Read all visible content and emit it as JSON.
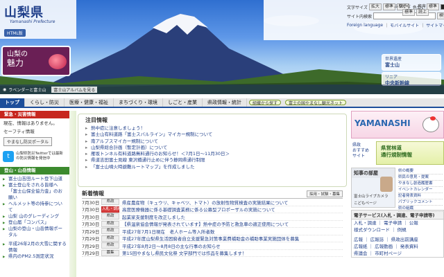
{
  "header": {
    "logo_title": "山梨県",
    "logo_sub": "Yamanashi Prefecture",
    "html_btn": "HTML版",
    "font_size_label": "文字サイズ",
    "font_enlarge": "拡大",
    "font_normal": "標準",
    "font_shrink": "縮小",
    "color_label": "色合い",
    "color_normal": "標準",
    "furigana": "ふりがな",
    "audio": "音声",
    "furigana_normal": "標準",
    "audio_read": "読上",
    "search_label": "サイト内検索",
    "search_button": "検索",
    "link_foreign": "Foreign language",
    "link_mobile": "モバイルサイト",
    "link_sitemap": "サイトマップ"
  },
  "hero": {
    "miryoku_line1": "山梨の",
    "miryoku_line2": "魅力",
    "banner1_line1": "世界遺産",
    "banner1_line2": "富士山",
    "banner2_line1": "リニア",
    "banner2_line2": "中央新幹線",
    "crumb1": "ラベンダーと富士山",
    "crumb2": "富士山アルバムを見る"
  },
  "nav": {
    "items": [
      "トップ",
      "くらし・防災",
      "医療・健康・福祉",
      "まちづくり・環境",
      "しごと・産業",
      "県政情報・統計"
    ],
    "pill1": "組織から探す",
    "pill2": "富士の国やまなし観光ネット"
  },
  "left": {
    "emergency_head": "緊急・災害情報",
    "emergency_text1": "現在、情報はありません。",
    "emergency_text2": "セーフティ情報",
    "bosai_btn": "やまなし防災ポータル",
    "twitter_text": "山梨県防災Twitterでは最新の防災情報を発信中",
    "mountain_head": "登山・山岳情報",
    "mountain_items": [
      "富士山吉田ルート登下山道",
      "富士登山をされる皆様へ「富士山保全協力金」のお願い",
      "ヘルメット等の持参について",
      "山梨 山のグレーディング",
      "登山届「コンパス」",
      "山梨の登山・山岳情報ポータル"
    ],
    "extra_items": [
      "平成26年2月の大雪に関する情報",
      "県内のPM2.5測定状況"
    ]
  },
  "notice": {
    "heading": "注目情報",
    "items": [
      "熱中症に注意しましょう！",
      "富士山有料道路「富士スバルライン」マイカー規制について",
      "南アルプスマイカー規制について",
      "山梨県総合計画（暫定計画）について",
      "雁坂トンネル有料道路無料通行のお知らせ！＜7月1日〜11月30日＞",
      "県道吉田富士見線 東沢橋通行止めに伴う静岡県通行制限",
      "「富士山噴火時避難ルートマップ」を作成しました"
    ]
  },
  "news": {
    "heading": "新着情報",
    "more": "採用・試験・募集",
    "rows": [
      {
        "date": "7月30日",
        "badge": "県政",
        "badge_red": false,
        "title": "県産農産物（キュウリ、キャベツ、トマト）の放射性物質検査の実施結果について"
      },
      {
        "date": "7月30日",
        "badge": "入札・調達",
        "badge_red": true,
        "title": "高度医療機器に係る基礎調査業務に係る公募型プロポーザルの実施について"
      },
      {
        "date": "7月30日",
        "badge": "県政",
        "badge_red": false,
        "title": "起業家支援制度を改正しました"
      },
      {
        "date": "7月30日",
        "badge": "県政",
        "badge_red": false,
        "title": "【県温泉協会情報が発表されています】熱中症の予防と救急車の適正使用について"
      },
      {
        "date": "7月29日",
        "badge": "県政",
        "badge_red": false,
        "title": "平成27年7月1日現在　老人ホーム等入所者数"
      },
      {
        "date": "7月29日",
        "badge": "県政",
        "badge_red": false,
        "title": "平成27年度山梨県生活困窮者自立支援緊急対策事業費補助金の補助事業実施団体を募集"
      },
      {
        "date": "7月29日",
        "badge": "県政",
        "badge_red": false,
        "title": "平成27年8月2日〜8月8日の主な行事のお知らせ"
      },
      {
        "date": "7月29日",
        "badge": "募集",
        "badge_red": false,
        "title": "第15回やまなし県民文化祭 文学部門では作品を募集します！"
      }
    ]
  },
  "right": {
    "yamanashi": "YAMANASHI",
    "kensei_line1": "県政",
    "kensei_line2": "おすすめ",
    "kensei_line3": "サイト",
    "road_line1": "県営林道",
    "road_line2": "通行規制情報",
    "chiji_head": "知事の部屋",
    "chiji_sub1": "富士山ライブカメラ",
    "chiji_sub2": "こどもページ",
    "chiji_links": [
      "県の概要",
      "県民の意見・提案",
      "やまなし創造履歴書",
      "イベントカレンダー",
      "記者発表資料",
      "パブリックコメント",
      "県の組織"
    ],
    "svc_head": "電子サービス(入札・調達、電子申請等)",
    "svc_row1": "入札・調達 ｜ 電子申請 ｜ 公報",
    "svc_row2": "様式ダウンロード ｜ 例規",
    "svc_row3": "広報 ｜ 広報誌 ｜ 県政出前講座",
    "svc_row4": "広報紙 ｜ 広報動画 ｜ 発表資料",
    "svc_row5": "県議会 ｜ 市町村ページ"
  }
}
